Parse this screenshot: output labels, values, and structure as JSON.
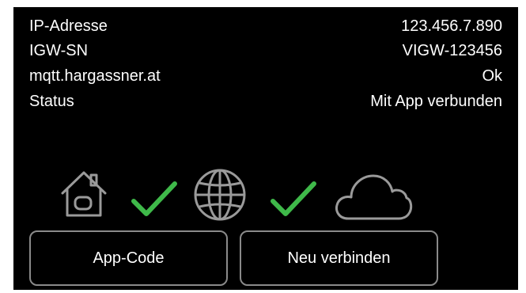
{
  "info": {
    "rows": [
      {
        "label": "IP-Adresse",
        "value": "123.456.7.890"
      },
      {
        "label": "IGW-SN",
        "value": "VIGW-123456"
      },
      {
        "label": "mqtt.hargassner.at",
        "value": "Ok"
      },
      {
        "label": "Status",
        "value": "Mit App verbunden"
      }
    ]
  },
  "connection": {
    "icons": [
      "home-icon",
      "check-icon",
      "globe-icon",
      "check-icon",
      "cloud-icon"
    ],
    "colors": {
      "check": "#3fb94a",
      "outline": "#9a9a9a"
    }
  },
  "buttons": {
    "app_code_label": "App-Code",
    "reconnect_label": "Neu verbinden"
  }
}
